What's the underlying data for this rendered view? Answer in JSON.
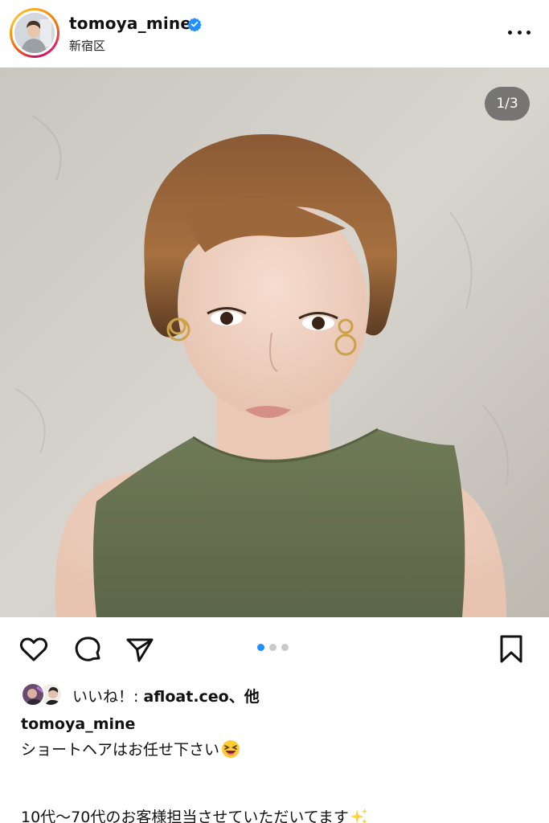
{
  "post": {
    "username": "tomoya_mine",
    "location": "新宿区",
    "verified": true,
    "image_counter": "1/3",
    "carousel": {
      "total": 3,
      "active_index": 0
    }
  },
  "actions": {
    "like_icon": "heart-icon",
    "comment_icon": "comment-icon",
    "share_icon": "send-icon",
    "save_icon": "bookmark-icon"
  },
  "likes": {
    "prefix": "いいね！: ",
    "user": "afloat.ceo",
    "suffix": "、他"
  },
  "caption": {
    "username": "tomoya_mine",
    "line1": "ショートヘアはお任せ下さい",
    "line2": "10代〜70代のお客様担当させていただいてます"
  },
  "colors": {
    "accent": "#1e90ff",
    "verified": "#1e90ff",
    "text": "#111111"
  }
}
